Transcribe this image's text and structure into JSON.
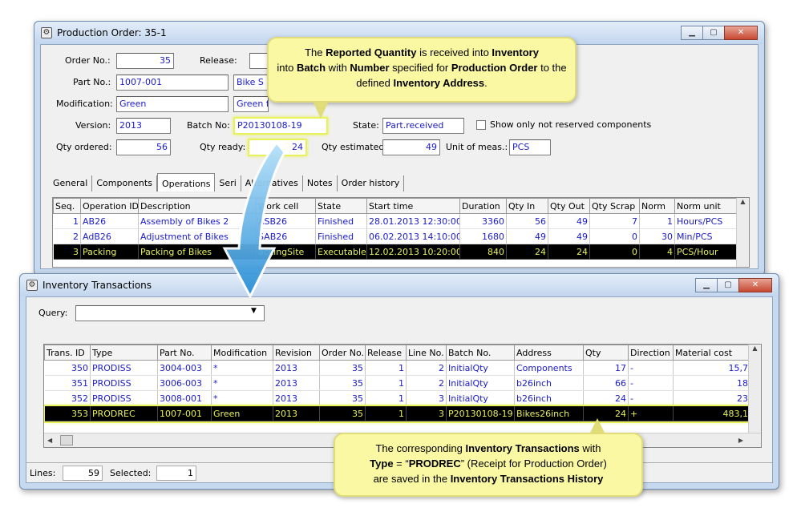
{
  "prod_window": {
    "title": "Production Order: 35-1",
    "labels": {
      "order_no": "Order No.:",
      "release": "Release:",
      "part_no": "Part No.:",
      "modification": "Modification:",
      "version": "Version:",
      "batch_no": "Batch No:",
      "state": "State:",
      "show_only": "Show only not reserved components",
      "qty_ordered": "Qty ordered:",
      "qty_ready": "Qty ready:",
      "qty_estimated": "Qty estimated:",
      "unit_of_meas": "Unit of meas.:"
    },
    "values": {
      "order_no": "35",
      "part_no": "1007-001",
      "part_name": "Bike S",
      "modification": "Green",
      "modification_desc": "Green frame + Gre",
      "version": "2013",
      "batch_no": "P20130108-19",
      "state": "Part.received",
      "qty_ordered": "56",
      "qty_ready": "24",
      "qty_estimated": "49",
      "unit_of_meas": "PCS"
    },
    "tabs": [
      "General",
      "Components",
      "Operations",
      "Seri",
      "Alternatives",
      "Notes",
      "Order history"
    ],
    "active_tab": "Operations",
    "grid": {
      "headers": [
        "Seq.",
        "Operation ID",
        "Description",
        "Work cell",
        "State",
        "Start time",
        "Duration",
        "Qty In",
        "Qty Out",
        "Qty Scrap",
        "Norm",
        "Norm unit"
      ],
      "rows": [
        [
          "1",
          "AB26",
          "Assembly of Bikes 2",
          "ASB26",
          "Finished",
          "28.01.2013 12:30:00",
          "3360",
          "56",
          "49",
          "7",
          "1",
          "Hours/PCS"
        ],
        [
          "2",
          "AdB26",
          "Adjustment of Bikes",
          "SAB26",
          "Finished",
          "06.02.2013 14:10:00",
          "1680",
          "49",
          "49",
          "0",
          "30",
          "Min/PCS"
        ],
        [
          "3",
          "Packing",
          "Packing of Bikes",
          "ackingSite",
          "Executable",
          "12.02.2013 10:20:00",
          "840",
          "24",
          "24",
          "0",
          "4",
          "PCS/Hour"
        ]
      ]
    }
  },
  "inv_window": {
    "title": "Inventory Transactions",
    "query_label": "Query:",
    "query_value": "",
    "grid": {
      "headers": [
        "Trans. ID",
        "Type",
        "Part No.",
        "Modification",
        "Revision",
        "Order No.",
        "Release",
        "Line No.",
        "Batch No.",
        "Address",
        "Qty",
        "Direction",
        "Material cost"
      ],
      "rows": [
        [
          "350",
          "PRODISS",
          "3004-003",
          "*",
          "2013",
          "35",
          "1",
          "2",
          "InitialQty",
          "Components",
          "17",
          "-",
          "15,7"
        ],
        [
          "351",
          "PRODISS",
          "3006-003",
          "*",
          "2013",
          "35",
          "1",
          "2",
          "InitialQty",
          "b26inch",
          "66",
          "-",
          "18"
        ],
        [
          "352",
          "PRODISS",
          "3008-001",
          "*",
          "2013",
          "35",
          "1",
          "3",
          "InitialQty",
          "b26inch",
          "24",
          "-",
          "23"
        ],
        [
          "353",
          "PRODREC",
          "1007-001",
          "Green",
          "2013",
          "35",
          "1",
          "3",
          "P20130108-19",
          "Bikes26inch",
          "24",
          "+",
          "483,1"
        ]
      ]
    },
    "status": {
      "lines_label": "Lines:",
      "lines_value": "59",
      "selected_label": "Selected:",
      "selected_value": "1"
    }
  },
  "callout_top": {
    "p1": "The ",
    "b1": "Reported Quantity",
    "p2": " is received into ",
    "b2": "Inventory",
    "p3": " into ",
    "b3": "Batch",
    "p4": " with ",
    "b4": "Number",
    "p5": " specified for ",
    "b5": "Production Order",
    "p6": " to the defined ",
    "b6": "Inventory Address",
    "p7": "."
  },
  "callout_bottom": {
    "p1": "The corresponding ",
    "b1": "Inventory Transactions",
    "p2": " with ",
    "b2": "Type",
    "p3": " = “",
    "b3": "PRODREC",
    "p4": "” (Receipt for Production Order)",
    "p5": "are saved in the ",
    "b4": "Inventory Transactions History"
  },
  "colors": {
    "field_text": "#1a1acc",
    "highlight": "#e8f15a",
    "callout_bg": "#fbf8a3",
    "arrow": "#3aa0e0"
  }
}
